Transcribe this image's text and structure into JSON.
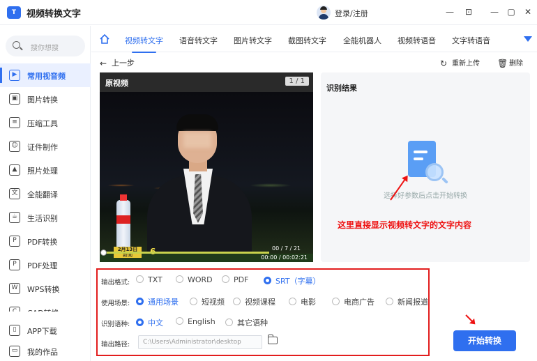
{
  "app": {
    "logo_text": "T",
    "title": "视频转换文字",
    "login": "登录/注册"
  },
  "window": {
    "min": "—",
    "restore": "▢",
    "close": "✕",
    "extra": "⊡"
  },
  "sidebar": {
    "search_placeholder": "搜你想搜",
    "items": [
      {
        "label": "常用视音频",
        "icon": "video-audio-icon",
        "glyph": "▶"
      },
      {
        "label": "图片转换",
        "icon": "image-convert-icon",
        "glyph": "▣"
      },
      {
        "label": "压缩工具",
        "icon": "compress-icon",
        "glyph": "≡"
      },
      {
        "label": "证件制作",
        "icon": "id-photo-icon",
        "glyph": "☺"
      },
      {
        "label": "照片处理",
        "icon": "photo-edit-icon",
        "glyph": "▲"
      },
      {
        "label": "全能翻译",
        "icon": "translate-icon",
        "glyph": "文"
      },
      {
        "label": "生活识别",
        "icon": "life-recognize-icon",
        "glyph": "☕"
      },
      {
        "label": "PDF转换",
        "icon": "pdf-convert-icon",
        "glyph": "P"
      },
      {
        "label": "PDF处理",
        "icon": "pdf-process-icon",
        "glyph": "P"
      },
      {
        "label": "WPS转换",
        "icon": "wps-icon",
        "glyph": "W"
      },
      {
        "label": "CAD转换",
        "icon": "cad-icon",
        "glyph": "C"
      }
    ],
    "bottom": [
      {
        "label": "APP下载",
        "icon": "phone-icon",
        "glyph": "▯"
      },
      {
        "label": "我的作品",
        "icon": "folder-icon",
        "glyph": "▭"
      }
    ]
  },
  "tabs": [
    "视频转文字",
    "语音转文字",
    "图片转文字",
    "截图转文字",
    "全能机器人",
    "视频转语音",
    "文字转语音"
  ],
  "toolbar": {
    "back": "上一步",
    "reupload": "重新上传",
    "delete": "删除"
  },
  "video": {
    "title": "原视频",
    "page": "1 / 1",
    "date_badge_line1": "2月13日",
    "date_badge_line2": "新闻",
    "logo_badge": "6",
    "time_top": "00 / 7 / 21",
    "time_bottom": "00:00 / 00:02:21",
    "progress": 0.78
  },
  "result": {
    "title": "识别结果",
    "hint": "选择好参数后点击开始转换",
    "annotation": "这里直接显示视频转文字的文字内容"
  },
  "settings": {
    "format": {
      "label": "输出格式:",
      "options": [
        "TXT",
        "WORD",
        "PDF",
        "SRT（字幕）"
      ],
      "selected": 3
    },
    "scene": {
      "label": "使用场景:",
      "options": [
        "通用场景",
        "短视频",
        "视频课程",
        "电影",
        "电商广告",
        "新闻报道"
      ],
      "selected": 0
    },
    "language": {
      "label": "识别语种:",
      "options": [
        "中文",
        "English",
        "其它语种"
      ],
      "selected": 0
    },
    "path": {
      "label": "输出路径:",
      "value": "C:\\Users\\Administrator\\desktop"
    }
  },
  "start_button": "开始转换",
  "colors": {
    "accent": "#2f6fef",
    "annotation": "#e11d1d"
  }
}
